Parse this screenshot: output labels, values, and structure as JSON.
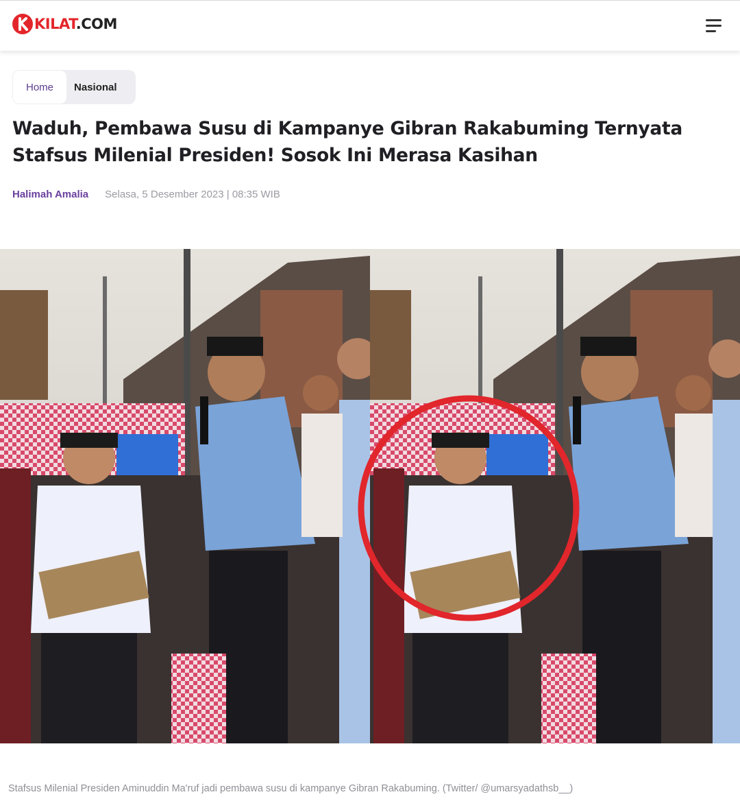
{
  "site": {
    "logo_text_main": "KILAT",
    "logo_text_suffix": ".COM",
    "brand_color": "#e3262b"
  },
  "breadcrumb": {
    "home": "Home",
    "category": "Nasional"
  },
  "article": {
    "title": "Waduh, Pembawa Susu di Kampanye Gibran Rakabuming Ternyata Stafsus Milenial Presiden! Sosok Ini Merasa Kasihan",
    "author": "Halimah Amalia",
    "date": "Selasa, 5 Desember 2023 | 08:35 WIB",
    "image_caption": "Stafsus Milenial Presiden Aminuddin Ma'ruf jadi pembawa susu di kampanye Gibran Rakabuming. (Twitter/ @umarsyadathsb__)"
  },
  "icons": {
    "menu": "hamburger-menu-icon",
    "logo": "kilat-logo-icon"
  },
  "colors": {
    "accent_purple": "#6a3f9e",
    "highlight_circle": "#e1262c"
  }
}
